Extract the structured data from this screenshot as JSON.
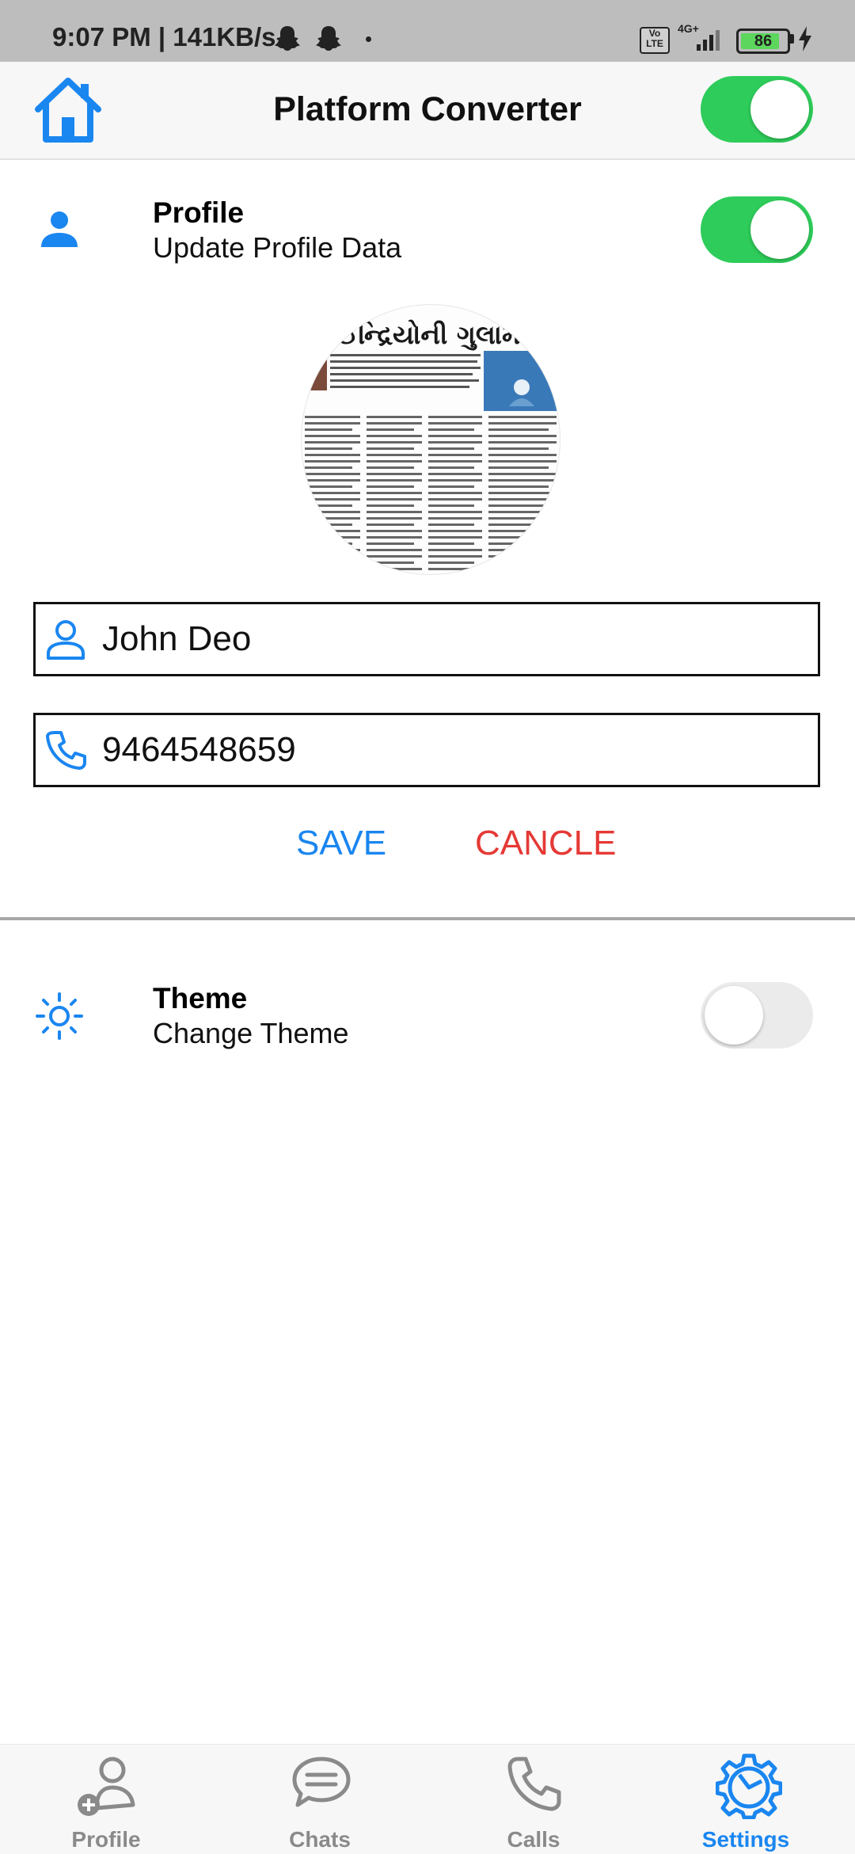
{
  "status_bar": {
    "time": "9:07 PM | 141KB/s",
    "network_type": "4G+",
    "volte": "Vo LTE",
    "battery_percent": "86",
    "battery_level": 0.86
  },
  "app_bar": {
    "title": "Platform Converter",
    "home_icon": "home-icon",
    "toggle_on": true
  },
  "profile_section": {
    "title": "Profile",
    "subtitle": "Update Profile Data",
    "icon": "person-icon",
    "toggle_on": true,
    "avatar_text": "ન ઈન્દ્રિયોની ગુલામી",
    "name_value": "John Deo",
    "phone_value": "9464548659",
    "save_label": "SAVE",
    "cancel_label": "CANCLE"
  },
  "theme_section": {
    "title": "Theme",
    "subtitle": "Change Theme",
    "icon": "sun-icon",
    "toggle_on": false
  },
  "bottom_nav": {
    "items": [
      {
        "label": "Profile",
        "icon": "add-person-icon"
      },
      {
        "label": "Chats",
        "icon": "chat-bubble-icon"
      },
      {
        "label": "Calls",
        "icon": "phone-icon"
      },
      {
        "label": "Settings",
        "icon": "gear-icon"
      }
    ],
    "active": "Settings"
  },
  "colors": {
    "accent": "#1a86f0",
    "toggle_on": "#2ecc5a",
    "cancel": "#e53935"
  }
}
